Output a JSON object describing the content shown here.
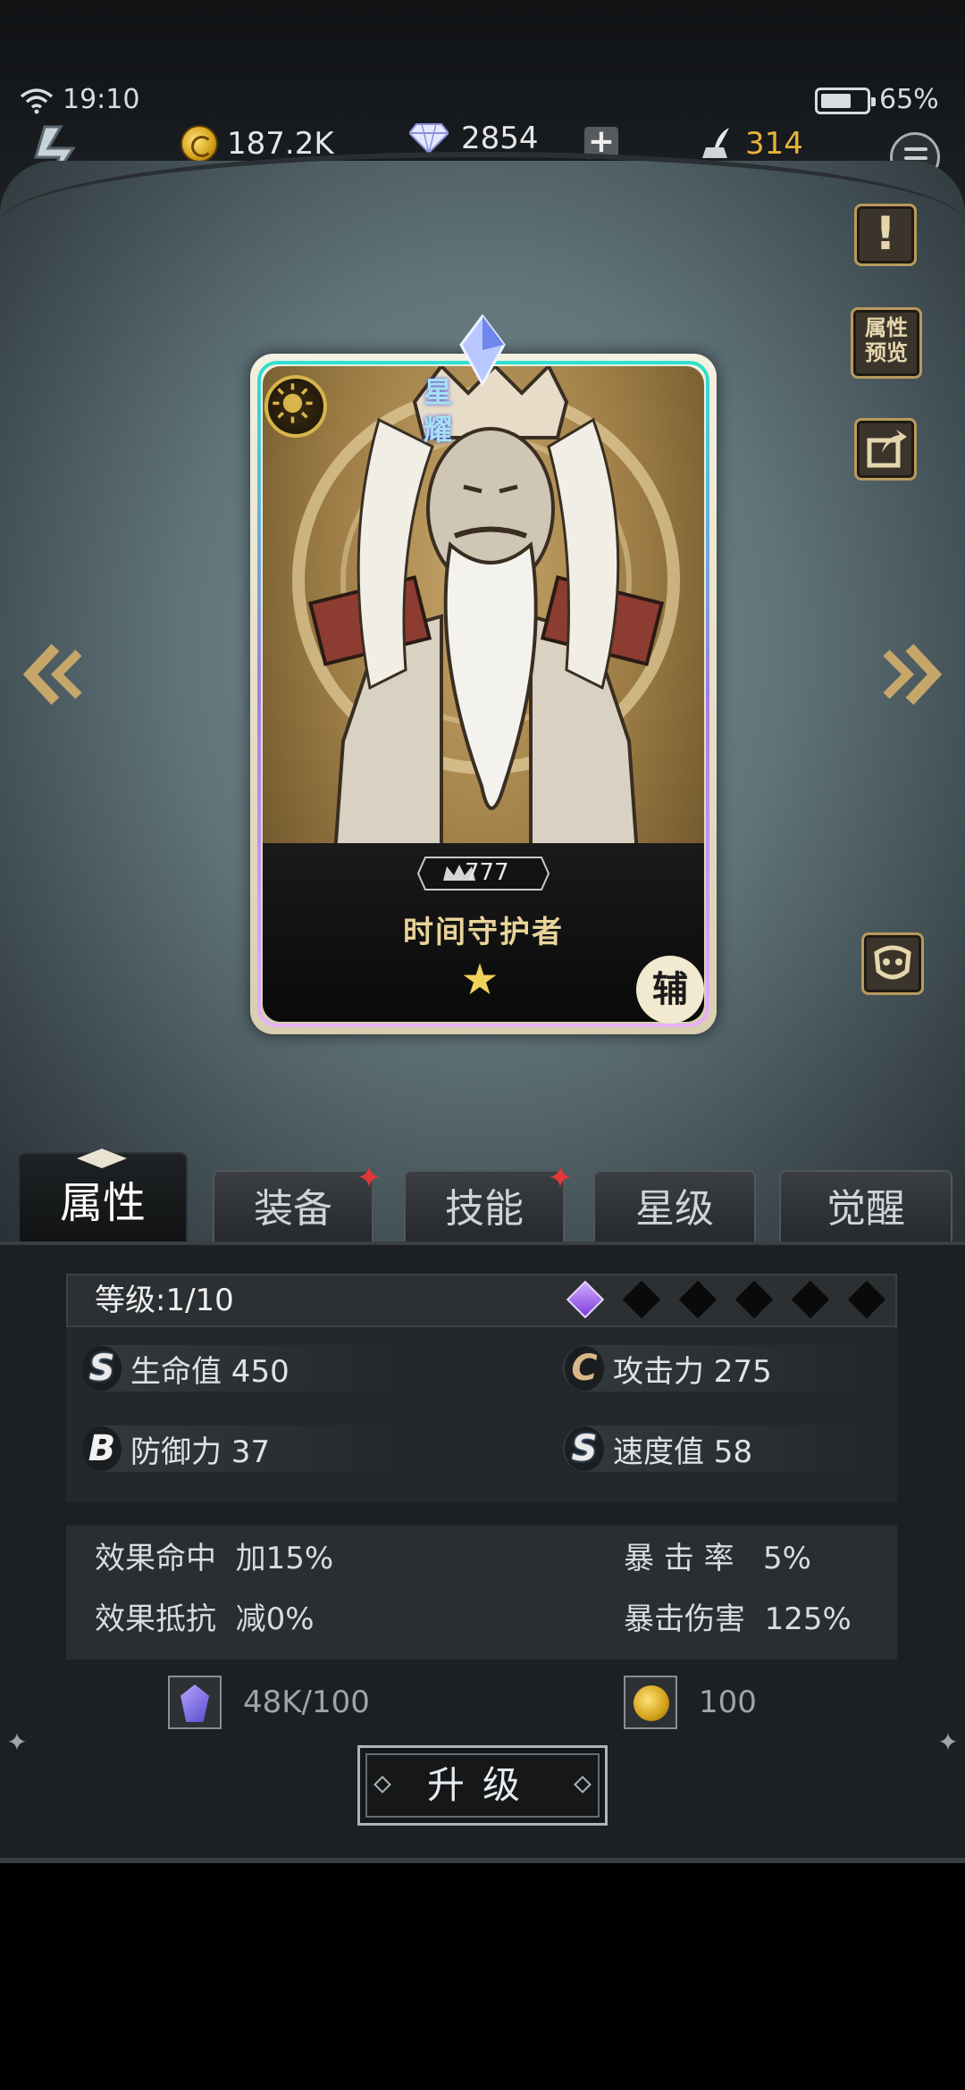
{
  "status_bar": {
    "time": "19:10",
    "battery_percent_text": "65%",
    "battery_level": 0.65
  },
  "resources": {
    "gold": "187.2K",
    "diamonds": "2854",
    "plus_label": "+",
    "stamina": "314"
  },
  "side_buttons": {
    "info_label": "!",
    "attr_preview_label": "属性\n预览"
  },
  "card": {
    "rarity_label": "星耀",
    "level_badge": "777",
    "name": "时间守护者",
    "star_glyph": "★",
    "role_label": "辅"
  },
  "tabs": [
    {
      "label": "属性",
      "active": true,
      "badge": false
    },
    {
      "label": "装备",
      "active": false,
      "badge": true
    },
    {
      "label": "技能",
      "active": false,
      "badge": true
    },
    {
      "label": "星级",
      "active": false,
      "badge": false
    },
    {
      "label": "觉醒",
      "active": false,
      "badge": false
    }
  ],
  "badge_glyph": "✦",
  "level": {
    "label": "等级:1/10",
    "awaken_total": 6,
    "awaken_filled": 1
  },
  "stats": {
    "hp": {
      "grade": "S",
      "label": "生命值 450"
    },
    "atk": {
      "grade": "C",
      "label": "攻击力 275"
    },
    "def": {
      "grade": "B",
      "label": "防御力 37"
    },
    "spd": {
      "grade": "S",
      "label": "速度值 58"
    }
  },
  "sub_stats": {
    "effect_hit": "效果命中  加15%",
    "effect_resist": "效果抵抗  减0%",
    "crit_rate": "暴 击 率   5%",
    "crit_damage": "暴击伤害  125%"
  },
  "costs": {
    "crystal": "48K/100",
    "gold": "100"
  },
  "upgrade_label": "升级",
  "colors": {
    "accent_gold": "#e8b33a",
    "badge_red": "#e23838"
  }
}
